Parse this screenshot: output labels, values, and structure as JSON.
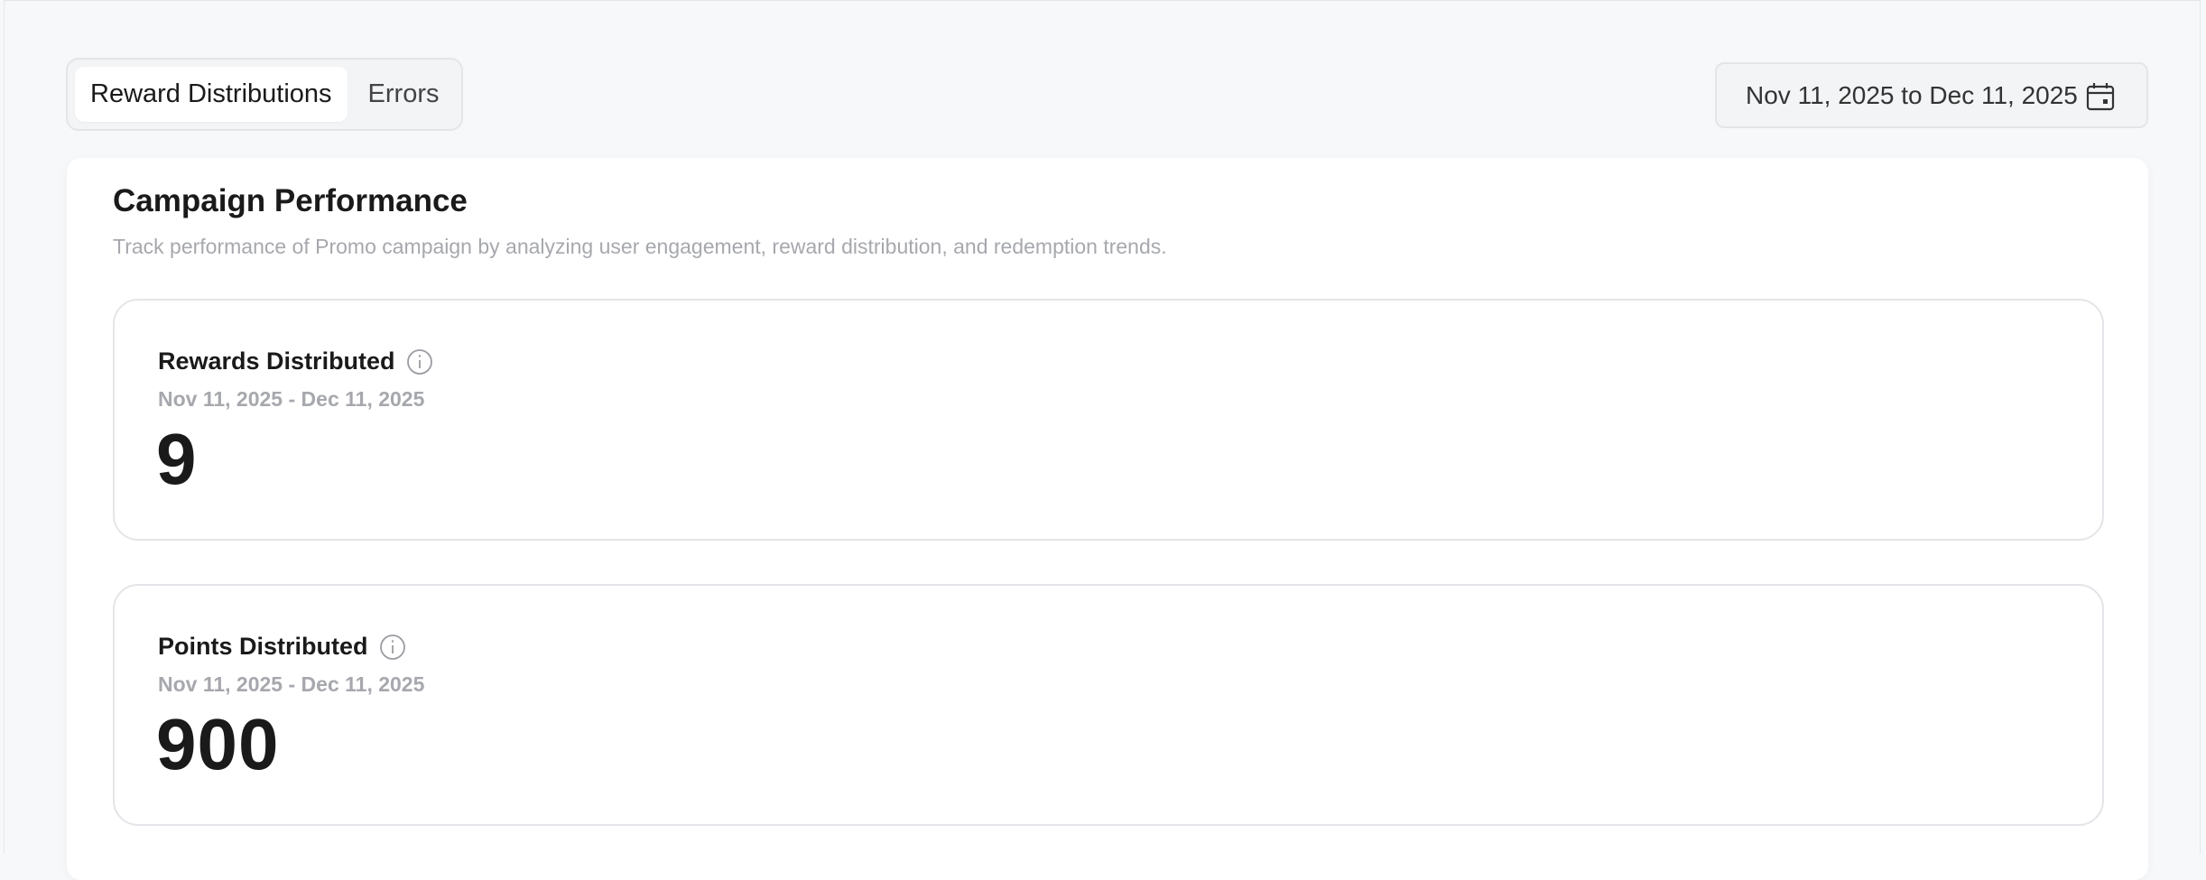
{
  "tabs": [
    {
      "label": "Reward Distributions",
      "active": true
    },
    {
      "label": "Errors",
      "active": false
    }
  ],
  "date_range": {
    "label": "Nov 11, 2025 to Dec 11, 2025",
    "icon": "calendar-icon"
  },
  "panel": {
    "title": "Campaign Performance",
    "subtitle": "Track performance of Promo campaign by analyzing user engagement, reward distribution, and redemption trends."
  },
  "metrics": [
    {
      "label": "Rewards Distributed",
      "range": "Nov 11, 2025 - Dec 11, 2025",
      "value": "9",
      "icon": "info-icon"
    },
    {
      "label": "Points Distributed",
      "range": "Nov 11, 2025 - Dec 11, 2025",
      "value": "900",
      "icon": "info-icon"
    }
  ],
  "colors": {
    "page_bg": "#f7f8fa",
    "card_bg": "#ffffff",
    "border": "#e3e5e8",
    "muted_text": "#a6a8ad",
    "text": "#1a1a1a"
  }
}
